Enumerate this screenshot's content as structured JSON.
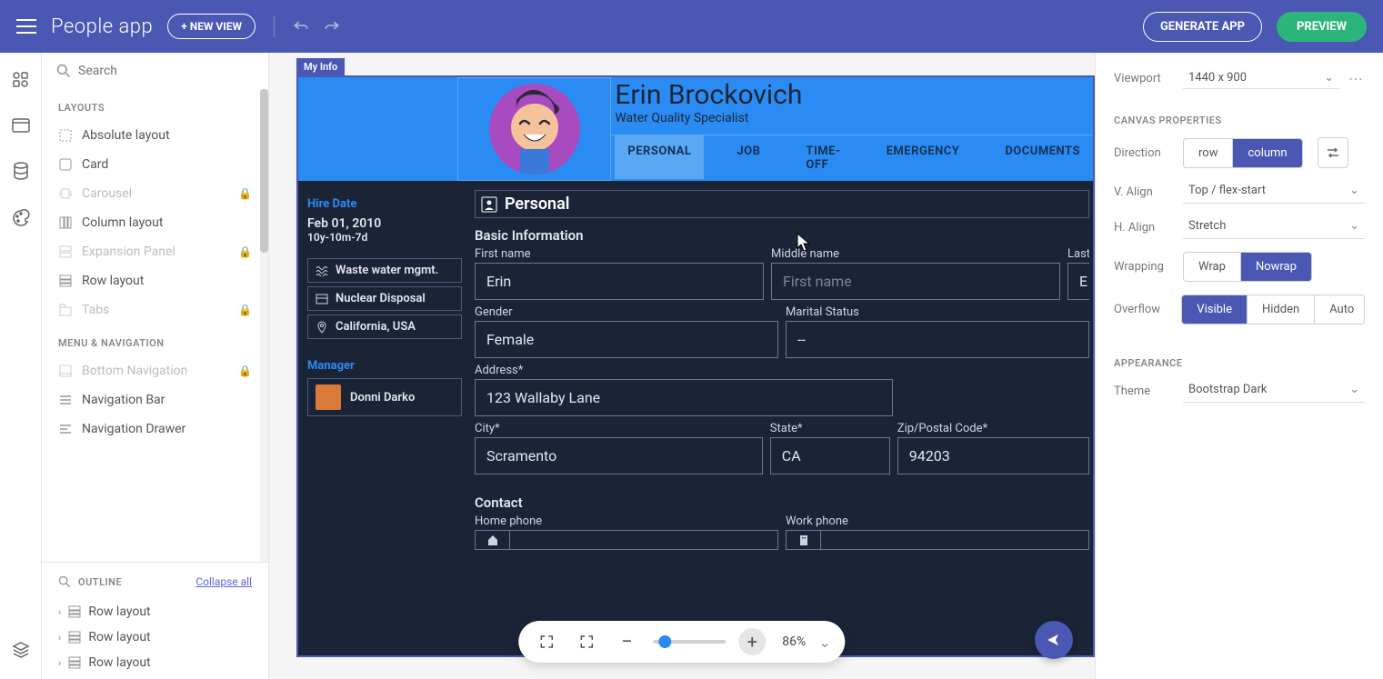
{
  "topbar": {
    "app_title": "People app",
    "new_view_btn": "+ NEW VIEW",
    "generate_btn": "GENERATE APP",
    "preview_btn": "PREVIEW"
  },
  "left": {
    "search_placeholder": "Search",
    "cat_layouts": "LAYOUTS",
    "items_layouts": [
      "Absolute layout",
      "Card",
      "Carousel",
      "Column layout",
      "Expansion Panel",
      "Row layout",
      "Tabs"
    ],
    "cat_menu": "MENU & NAVIGATION",
    "items_menu": [
      "Bottom Navigation",
      "Navigation Bar",
      "Navigation Drawer"
    ],
    "outline_label": "OUTLINE",
    "collapse_label": "Collapse all",
    "tree": [
      "Row layout",
      "Row layout",
      "Row layout"
    ]
  },
  "canvas": {
    "badge": "My Info",
    "name": "Erin Brockovich",
    "role": "Water Quality Specialist",
    "tabs": [
      "PERSONAL",
      "JOB",
      "TIME-OFF",
      "EMERGENCY",
      "DOCUMENTS"
    ],
    "side": {
      "hire_label": "Hire Date",
      "hire_date": "Feb 01, 2010",
      "hire_span": "10y-10m-7d",
      "chips": [
        "Waste water mgmt.",
        "Nuclear Disposal",
        "California, USA"
      ],
      "manager_label": "Manager",
      "manager_name": "Donni Darko"
    },
    "form": {
      "section": "Personal",
      "basic": "Basic Information",
      "first_lbl": "First name",
      "first_val": "Erin",
      "middle_lbl": "Middle name",
      "middle_ph": "First name",
      "last_lbl": "Last",
      "gender_lbl": "Gender",
      "gender_val": "Female",
      "marital_lbl": "Marital Status",
      "marital_val": "--",
      "addr_lbl": "Address*",
      "addr_val": "123 Wallaby Lane",
      "city_lbl": "City*",
      "city_val": "Scramento",
      "state_lbl": "State*",
      "state_val": "CA",
      "zip_lbl": "Zip/Postal Code*",
      "zip_val": "94203",
      "contact": "Contact",
      "home_lbl": "Home phone",
      "work_lbl": "Work phone"
    },
    "zoom": "86%"
  },
  "right": {
    "viewport_lbl": "Viewport",
    "viewport_val": "1440 x 900",
    "sect_canvas": "CANVAS PROPERTIES",
    "direction_lbl": "Direction",
    "direction_opts": [
      "row",
      "column"
    ],
    "valign_lbl": "V. Align",
    "valign_val": "Top / flex-start",
    "halign_lbl": "H. Align",
    "halign_val": "Stretch",
    "wrap_lbl": "Wrapping",
    "wrap_opts": [
      "Wrap",
      "Nowrap"
    ],
    "over_lbl": "Overflow",
    "over_opts": [
      "Visible",
      "Hidden",
      "Auto"
    ],
    "sect_app": "APPEARANCE",
    "theme_lbl": "Theme",
    "theme_val": "Bootstrap Dark"
  }
}
